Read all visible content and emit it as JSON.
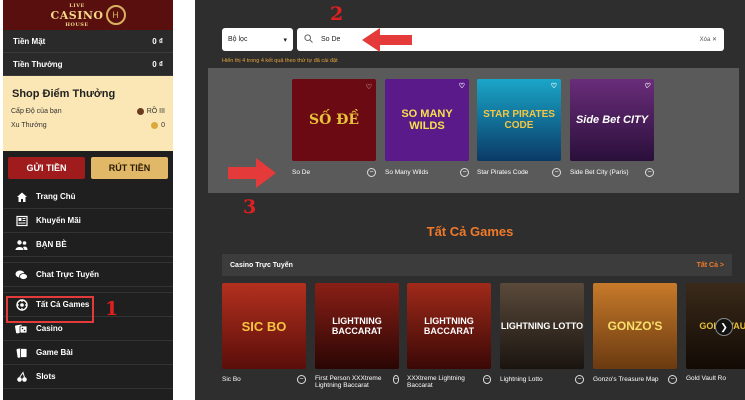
{
  "sidebar": {
    "logo": {
      "top": "LIVE",
      "main": "CASINO",
      "bottom": "HOUSE",
      "mark": "H"
    },
    "balances": [
      {
        "label": "Tiền Mặt",
        "value": "0 ₫"
      },
      {
        "label": "Tiền Thưởng",
        "value": "0 ₫"
      }
    ],
    "shop": {
      "title": "Shop Điểm Thưởng",
      "level_label": "Cấp Độ của bạn",
      "level_value": "RỒ III",
      "coins_label": "Xu Thưởng",
      "coins_value": "0"
    },
    "deposit_label": "GỬI TIỀN",
    "withdraw_label": "RÚT TIỀN",
    "nav": [
      {
        "label": "Trang Chủ",
        "icon": "home-icon"
      },
      {
        "label": "Khuyến Mãi",
        "icon": "news-icon"
      },
      {
        "label": "BẠN BÈ",
        "icon": "friends-icon"
      },
      {
        "label": "Chat Trực Tuyến",
        "icon": "chat-icon"
      },
      {
        "label": "Tất Cả Games",
        "icon": "games-icon"
      },
      {
        "label": "Casino",
        "icon": "casino-icon"
      },
      {
        "label": "Game Bài",
        "icon": "cards-icon"
      },
      {
        "label": "Slots",
        "icon": "cherries-icon"
      }
    ]
  },
  "main": {
    "filter_label": "Bộ lọc",
    "search_value": "So De",
    "clear_label": "Xóa ✕",
    "hint": "Hiển thị 4 trong 4 kết quả theo thứ tự đã cài đặt",
    "results": [
      {
        "name": "So De",
        "art": "SỐ ĐỀ"
      },
      {
        "name": "So Many Wilds",
        "art": "SO MANY WILDS"
      },
      {
        "name": "Star Pirates Code",
        "art": "STAR PIRATES CODE"
      },
      {
        "name": "Side Bet City (Paris)",
        "art": "Side Bet CITY"
      }
    ],
    "section_title": "Tất Cả Games",
    "live_title": "Casino Trực Tuyến",
    "live_all": "Tất Cả >",
    "live_games": [
      {
        "name": "Sic Bo",
        "art": "SIC BO"
      },
      {
        "name": "First Person XXXtreme Lightning Baccarat",
        "art": "LIGHTNING BACCARAT"
      },
      {
        "name": "XXXtreme Lightning Baccarat",
        "art": "LIGHTNING BACCARAT"
      },
      {
        "name": "Lightning Lotto",
        "art": "LIGHTNING LOTTO"
      },
      {
        "name": "Gonzo's Treasure Map",
        "art": "GONZO'S"
      },
      {
        "name": "Gold Vault Ro",
        "art": "GOLD VAULT"
      }
    ]
  },
  "annotations": {
    "one": "1",
    "two": "2",
    "three": "3"
  },
  "colors": {
    "accent": "#f07a2a",
    "sidebar": "#1f1f1f",
    "deposit": "#a01c1c",
    "withdraw": "#e1b867",
    "annotation": "#e02020"
  }
}
